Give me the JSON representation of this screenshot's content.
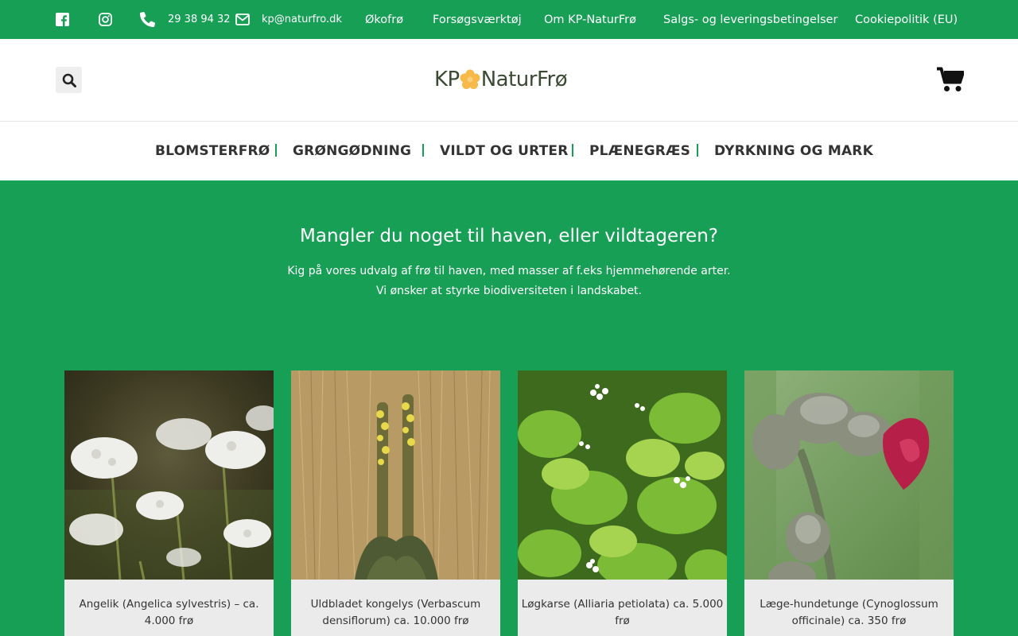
{
  "topbar": {
    "phone": "29 38 94 32",
    "email": "kp@naturfro.dk",
    "nav": [
      "Økofrø",
      "Forsøgsværktøj",
      "Om KP-NaturFrø",
      "Salgs- og leveringsbetingelser",
      "Cookiepolitik (EU)"
    ]
  },
  "header": {
    "logo_left": "KP",
    "logo_right": "NaturFrø"
  },
  "mainnav": [
    "BLOMSTERFRØ",
    "GRØNGØDNING",
    "VILDT OG URTER",
    "PLÆNEGRÆS",
    "DYRKNING OG MARK"
  ],
  "hero": {
    "title": "Mangler du noget til haven, eller vildtageren?",
    "line1": "Kig på vores udvalg af frø til haven, med masser af f.eks hjemmehørende arter.",
    "line2": "Vi ønsker at styrke biodiversiteten i landskabet."
  },
  "products": [
    {
      "title": "Angelik (Angelica sylvestris) – ca. 4.000 frø"
    },
    {
      "title": "Uldbladet kongelys (Verbascum densiflorum) ca. 10.000 frø"
    },
    {
      "title": "Løgkarse (Alliaria petiolata) ca. 5.000 frø"
    },
    {
      "title": "Læge-hundetunge (Cynoglossum officinale) ca. 350 frø"
    }
  ],
  "colors": {
    "brand_green": "#179f56",
    "logo_flower": "#f6b94a"
  }
}
